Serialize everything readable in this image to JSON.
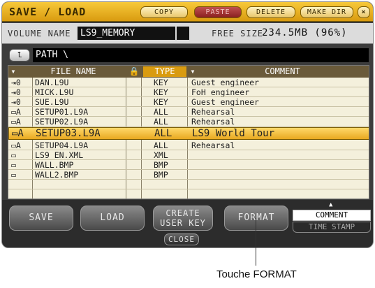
{
  "titlebar": {
    "title": "SAVE / LOAD",
    "copy": "COPY",
    "paste": "PASTE",
    "delete": "DELETE",
    "make_dir": "MAKE DIR",
    "close_x": "×"
  },
  "volume": {
    "name_label": "VOLUME NAME",
    "name_value": "LS9_MEMORY",
    "free_label": "FREE SIZE",
    "free_value": "234.5MB (96%)"
  },
  "path": {
    "label": "PATH",
    "value": "\\"
  },
  "table": {
    "headers": {
      "file_name": "FILE NAME",
      "lock": "🔒",
      "type": "TYPE",
      "comment": "COMMENT"
    },
    "rows": [
      {
        "icon": "⇥0",
        "name": "DAN.L9U",
        "type": "KEY",
        "comment": "Guest engineer"
      },
      {
        "icon": "⇥0",
        "name": "MICK.L9U",
        "type": "KEY",
        "comment": "FoH engineer"
      },
      {
        "icon": "⇥0",
        "name": "SUE.L9U",
        "type": "KEY",
        "comment": "Guest engineer"
      },
      {
        "icon": "▭A",
        "name": "SETUP01.L9A",
        "type": "ALL",
        "comment": "Rehearsal"
      },
      {
        "icon": "▭A",
        "name": "SETUP02.L9A",
        "type": "ALL",
        "comment": "Rehearsal"
      },
      {
        "icon": "▭A",
        "name": "SETUP03.L9A",
        "type": "ALL",
        "comment": "LS9 World Tour"
      },
      {
        "icon": "▭A",
        "name": "SETUP04.L9A",
        "type": "ALL",
        "comment": "Rehearsal"
      },
      {
        "icon": "▭",
        "name": "LS9_EN.XML",
        "type": "XML",
        "comment": ""
      },
      {
        "icon": "▭",
        "name": "WALL.BMP",
        "type": "BMP",
        "comment": ""
      },
      {
        "icon": "▭",
        "name": "WALL2.BMP",
        "type": "BMP",
        "comment": ""
      }
    ]
  },
  "bottom": {
    "save": "SAVE",
    "load": "LOAD",
    "create_line1": "CREATE",
    "create_line2": "USER KEY",
    "format": "FORMAT",
    "close": "CLOSE",
    "sort_comment": "COMMENT",
    "sort_timestamp": "TIME STAMP"
  },
  "annotation": {
    "label": "Touche FORMAT"
  }
}
